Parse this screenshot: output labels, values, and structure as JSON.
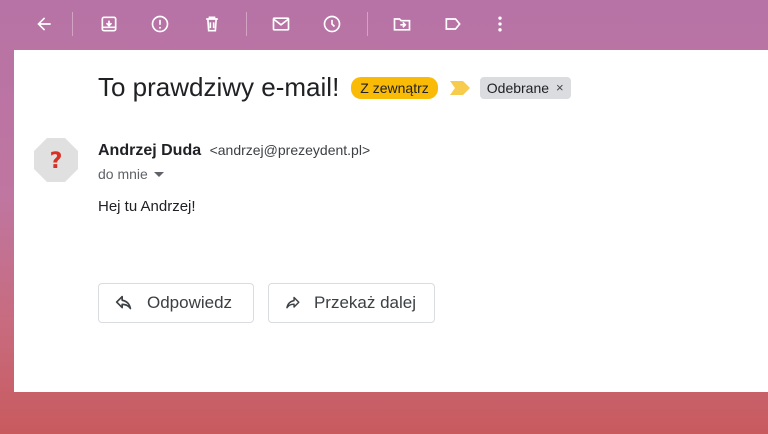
{
  "toolbar": {
    "icons": [
      "back-arrow-icon",
      "archive-icon",
      "report-spam-icon",
      "delete-icon",
      "mark-unread-icon",
      "snooze-icon",
      "move-to-icon",
      "label-icon",
      "more-vert-icon"
    ],
    "icon_color": "#ffffff"
  },
  "email": {
    "subject": "To prawdziwy e-mail!",
    "labels": {
      "external": "Z zewnątrz",
      "inbox": "Odebrane",
      "inbox_remove": "×"
    },
    "sender": {
      "name": "Andrzej Duda",
      "email": "<andrzej@prezeydent.pl>",
      "avatar_glyph": "?"
    },
    "to_line": "do mnie",
    "body": "Hej tu Andrzej!"
  },
  "actions": {
    "reply": "Odpowiedz",
    "forward": "Przekaż dalej"
  },
  "colors": {
    "external_label_bg": "#f9bb06",
    "important_marker": "#f7cb4d",
    "avatar_bg": "#e0e0e0",
    "avatar_glyph": "#d93025",
    "inbox_label_bg": "#dadce0"
  }
}
